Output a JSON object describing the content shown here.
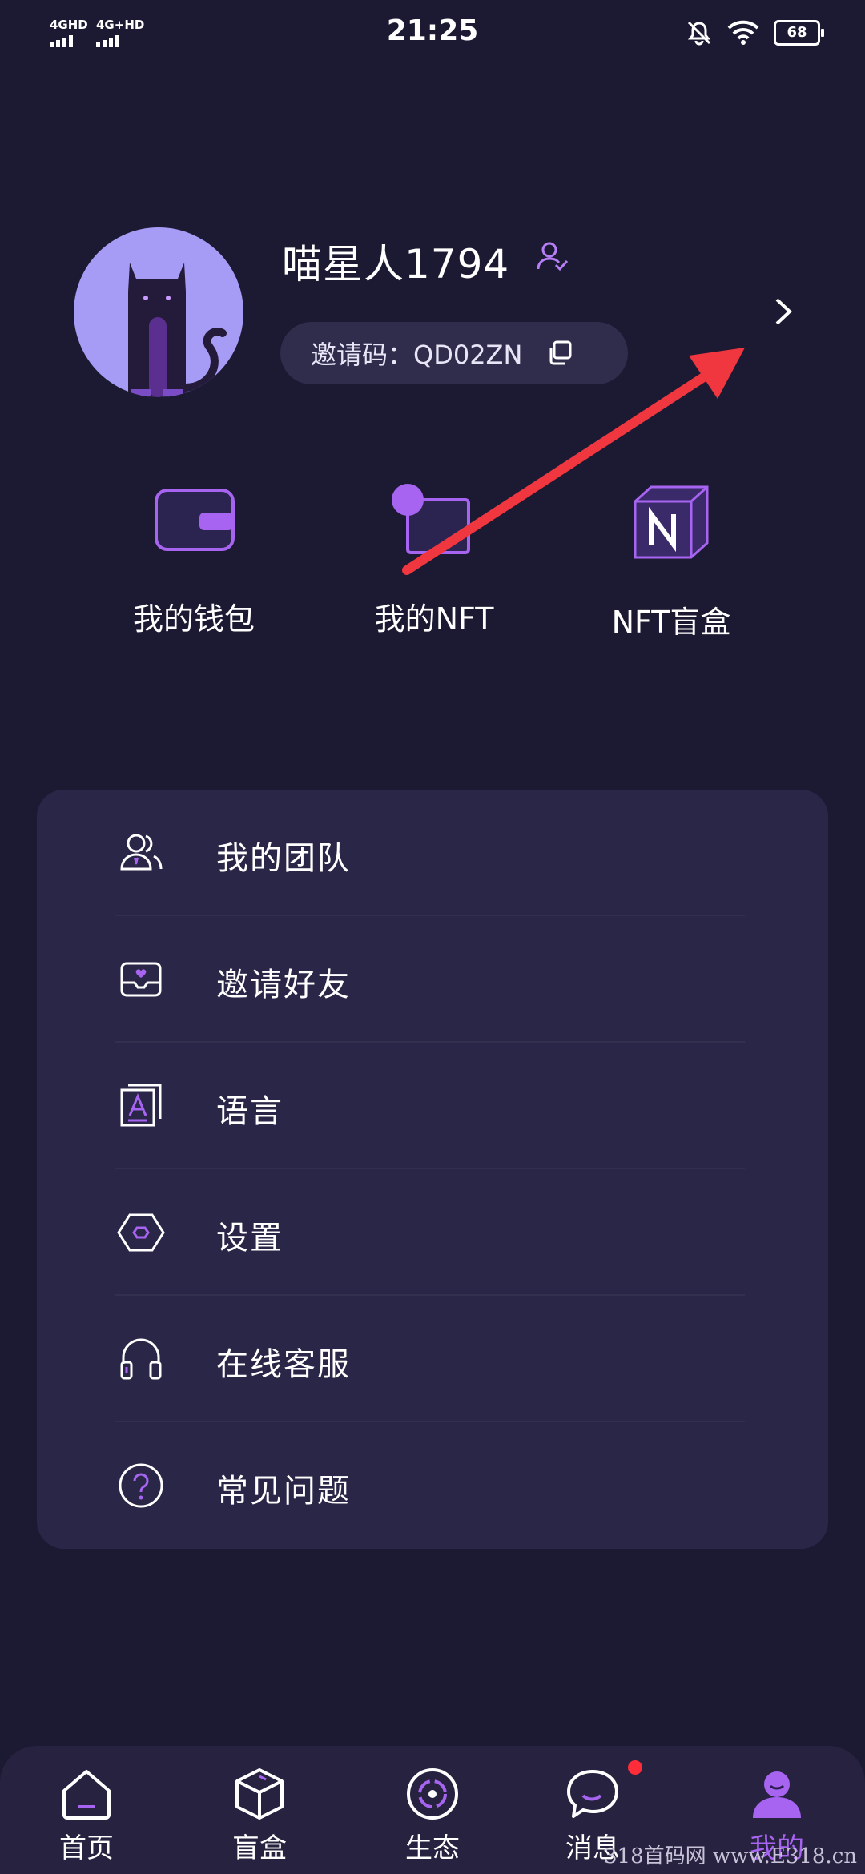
{
  "status_bar": {
    "signal1": "4GHD",
    "signal2": "4G+HD",
    "time": "21:25",
    "battery": "68"
  },
  "profile": {
    "username": "喵星人1794",
    "invite_code_label": "邀请码：QD02ZN"
  },
  "quick_actions": [
    {
      "label": "我的钱包",
      "icon": "wallet-icon"
    },
    {
      "label": "我的NFT",
      "icon": "nft-icon"
    },
    {
      "label": "NFT盲盒",
      "icon": "blind-box-icon"
    }
  ],
  "menu": [
    {
      "label": "我的团队",
      "icon": "team-icon"
    },
    {
      "label": "邀请好友",
      "icon": "invite-mail-icon"
    },
    {
      "label": "语言",
      "icon": "language-icon"
    },
    {
      "label": "设置",
      "icon": "settings-icon"
    },
    {
      "label": "在线客服",
      "icon": "headset-icon"
    },
    {
      "label": "常见问题",
      "icon": "faq-icon"
    }
  ],
  "tabs": [
    {
      "label": "首页",
      "icon": "home-icon"
    },
    {
      "label": "盲盒",
      "icon": "box-icon"
    },
    {
      "label": "生态",
      "icon": "ecology-icon"
    },
    {
      "label": "消息",
      "icon": "message-icon"
    },
    {
      "label": "我的",
      "icon": "profile-icon",
      "active": true
    }
  ],
  "watermark": "318首码网 www.E318.cn",
  "colors": {
    "background": "#1c1a33",
    "card": "#2a2647",
    "accent": "#a764f0",
    "annotation_arrow": "#f0363f"
  }
}
